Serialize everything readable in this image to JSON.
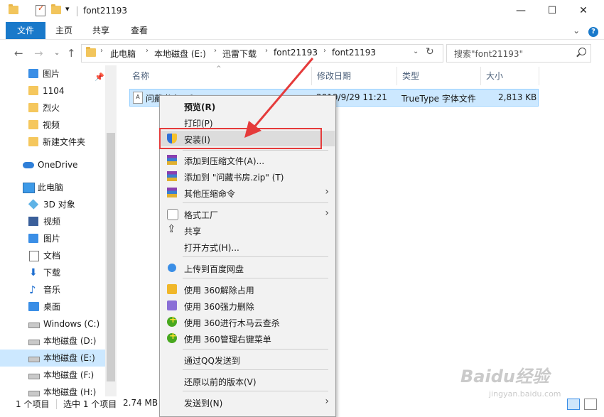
{
  "window": {
    "title": "font21193",
    "controls": {
      "minimize": "—",
      "maximize": "☐",
      "close": "✕"
    }
  },
  "ribbon": {
    "tabs": [
      "文件",
      "主页",
      "共享",
      "查看"
    ],
    "expand_glyph": "⌄",
    "help_glyph": "?"
  },
  "nav": {
    "back": "←",
    "forward": "→",
    "recent": "⌄",
    "up": "↑",
    "breadcrumbs": [
      "此电脑",
      "本地磁盘 (E:)",
      "迅雷下载",
      "font21193",
      "font21193"
    ],
    "breadcrumb_sep": "›",
    "dropdown": "⌄",
    "refresh": "↻",
    "search_placeholder": "搜索\"font21193\""
  },
  "navpane": {
    "items": [
      {
        "label": "图片",
        "icon": "pictures-icon",
        "pinned": true
      },
      {
        "label": "1104",
        "icon": "folder-icon"
      },
      {
        "label": "烈火",
        "icon": "folder-icon"
      },
      {
        "label": "视频",
        "icon": "folder-icon"
      },
      {
        "label": "新建文件夹",
        "icon": "folder-icon"
      },
      {
        "label": "OneDrive",
        "icon": "onedrive-icon"
      },
      {
        "label": "此电脑",
        "icon": "this-pc-icon"
      },
      {
        "label": "3D 对象",
        "icon": "3d-objects-icon"
      },
      {
        "label": "视频",
        "icon": "videos-icon"
      },
      {
        "label": "图片",
        "icon": "pictures-icon"
      },
      {
        "label": "文档",
        "icon": "documents-icon"
      },
      {
        "label": "下载",
        "icon": "downloads-icon"
      },
      {
        "label": "音乐",
        "icon": "music-icon"
      },
      {
        "label": "桌面",
        "icon": "desktop-icon"
      },
      {
        "label": "Windows (C:)",
        "icon": "drive-icon"
      },
      {
        "label": "本地磁盘 (D:)",
        "icon": "drive-icon"
      },
      {
        "label": "本地磁盘 (E:)",
        "icon": "drive-icon",
        "selected": true
      },
      {
        "label": "本地磁盘 (F:)",
        "icon": "drive-icon"
      },
      {
        "label": "本地磁盘 (H:)",
        "icon": "drive-icon"
      }
    ]
  },
  "list": {
    "columns": [
      "名称",
      "修改日期",
      "类型",
      "大小"
    ],
    "sort_glyph": "^",
    "rows": [
      {
        "name": "问藏书房.ttf",
        "modified": "2019/9/29 11:21",
        "type": "TrueType 字体文件",
        "size": "2,813 KB"
      }
    ]
  },
  "status": {
    "count": "1 个项目",
    "selected": "选中 1 个项目",
    "size": "2.74 MB"
  },
  "context_menu": {
    "items": [
      {
        "label": "预览(R)",
        "bold": true
      },
      {
        "label": "打印(P)"
      },
      {
        "label": "安装(I)",
        "icon": "uac-shield-icon",
        "highlighted": true
      },
      {
        "label": "添加到压缩文件(A)...",
        "icon": "winrar-icon"
      },
      {
        "label": "添加到 \"问藏书房.zip\" (T)",
        "icon": "winrar-icon"
      },
      {
        "label": "其他压缩命令",
        "icon": "winrar-icon",
        "submenu": true
      },
      {
        "label": "格式工厂",
        "icon": "format-factory-icon",
        "submenu": true
      },
      {
        "label": "共享",
        "icon": "share-icon"
      },
      {
        "label": "打开方式(H)..."
      },
      {
        "label": "上传到百度网盘",
        "icon": "baidu-netdisk-icon"
      },
      {
        "label": "使用 360解除占用",
        "icon": "360-unlock-icon"
      },
      {
        "label": "使用 360强力删除",
        "icon": "360-delete-icon"
      },
      {
        "label": "使用 360进行木马云查杀",
        "icon": "360-scan-icon"
      },
      {
        "label": "使用 360管理右键菜单",
        "icon": "360-menu-icon"
      },
      {
        "label": "通过QQ发送到"
      },
      {
        "label": "还原以前的版本(V)"
      },
      {
        "label": "发送到(N)",
        "submenu": true
      }
    ],
    "submenu_glyph": "›"
  },
  "annotation": {
    "color": "#e53b3b"
  },
  "watermark": {
    "logo": "Baidu经验",
    "url": "jingyan.baidu.com"
  },
  "colors": {
    "accent": "#1979ca",
    "selection": "#cce8ff",
    "menu_bg": "#f2f2f2"
  }
}
